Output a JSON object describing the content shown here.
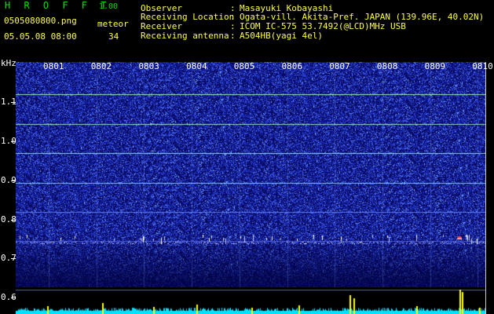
{
  "header": {
    "title": "H R O F F T",
    "version": "1.00",
    "filename": "0505080800.png",
    "datetime": "05.05.08 08:00",
    "meteor_label": "meteor",
    "meteor_count": "34"
  },
  "info": [
    {
      "key": "Observer",
      "value": "Masayuki Kobayashi"
    },
    {
      "key": "Receiving Location",
      "value": "Ogata-vill. Akita-Pref. JAPAN (139.96E, 40.02N)"
    },
    {
      "key": "Receiver",
      "value": "ICOM IC-575 53.7492(@LCD)MHz USB"
    },
    {
      "key": "Receiving antenna",
      "value": "A504HB(yagi 4el)"
    }
  ],
  "freq_unit": "kHz",
  "freq_ticks": [
    "1.1",
    "1.0",
    "0.9",
    "0.8",
    "0.7",
    "0.6"
  ],
  "time_labels": [
    "0801",
    "0802",
    "0803",
    "0804",
    "0805",
    "0806",
    "0807",
    "0808",
    "0809",
    "0810"
  ],
  "colors": {
    "background": "#000000",
    "spectrum_dark": "#0a0c6e",
    "spectrum_noise": "#2838d8",
    "carrier_line": "#8cf0a0",
    "meteor_echo": "#ff3c3c",
    "meter_base": "#00e0ff",
    "meter_peak": "#ffff00",
    "text_green": "#00e000",
    "text_yellow": "#ffff3c"
  }
}
